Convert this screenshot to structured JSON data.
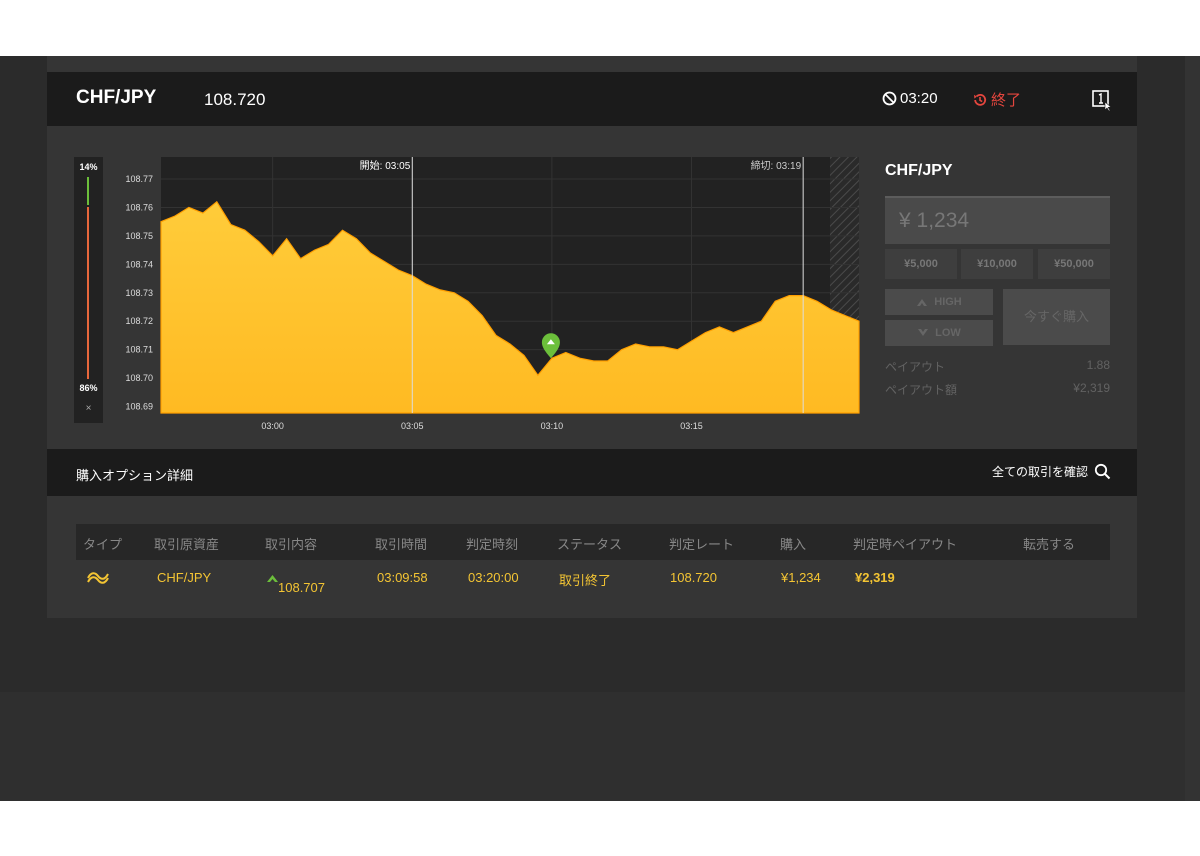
{
  "header": {
    "pair": "CHF/JPY",
    "rate": "108.720",
    "timer": "03:20",
    "status": "終了"
  },
  "sentiment": {
    "high_pct": "14%",
    "low_pct": "86%",
    "close_label": "×"
  },
  "chart_data": {
    "type": "area",
    "y_ticks": [
      "108.77",
      "108.76",
      "108.75",
      "108.74",
      "108.73",
      "108.72",
      "108.71",
      "108.70",
      "108.69"
    ],
    "x_ticks": [
      "03:00",
      "03:05",
      "03:10",
      "03:15"
    ],
    "x_range": [
      "02:56:00",
      "03:21:00"
    ],
    "y_range": [
      108.68,
      108.77
    ],
    "start_label": "開始: 03:05",
    "end_label": "締切: 03:19",
    "entry_marker": {
      "time": "03:09:58",
      "rate": 108.707
    },
    "series": [
      {
        "color": "#ffc833",
        "points": [
          [
            "02:56:00",
            108.755
          ],
          [
            "02:56:30",
            108.757
          ],
          [
            "02:57:00",
            108.76
          ],
          [
            "02:57:30",
            108.758
          ],
          [
            "02:58:00",
            108.762
          ],
          [
            "02:58:30",
            108.754
          ],
          [
            "02:59:00",
            108.752
          ],
          [
            "02:59:30",
            108.748
          ],
          [
            "03:00:00",
            108.743
          ],
          [
            "03:00:30",
            108.749
          ],
          [
            "03:01:00",
            108.742
          ],
          [
            "03:01:30",
            108.745
          ],
          [
            "03:02:00",
            108.747
          ],
          [
            "03:02:30",
            108.752
          ],
          [
            "03:03:00",
            108.749
          ],
          [
            "03:03:30",
            108.744
          ],
          [
            "03:04:00",
            108.741
          ],
          [
            "03:04:30",
            108.738
          ],
          [
            "03:05:00",
            108.736
          ],
          [
            "03:05:30",
            108.733
          ],
          [
            "03:06:00",
            108.731
          ],
          [
            "03:06:30",
            108.73
          ],
          [
            "03:07:00",
            108.727
          ],
          [
            "03:07:30",
            108.722
          ],
          [
            "03:08:00",
            108.715
          ],
          [
            "03:08:30",
            108.712
          ],
          [
            "03:09:00",
            108.708
          ],
          [
            "03:09:30",
            108.701
          ],
          [
            "03:10:00",
            108.707
          ],
          [
            "03:10:30",
            108.709
          ],
          [
            "03:11:00",
            108.707
          ],
          [
            "03:11:30",
            108.706
          ],
          [
            "03:12:00",
            108.706
          ],
          [
            "03:12:30",
            108.71
          ],
          [
            "03:13:00",
            108.712
          ],
          [
            "03:13:30",
            108.711
          ],
          [
            "03:14:00",
            108.711
          ],
          [
            "03:14:30",
            108.71
          ],
          [
            "03:15:00",
            108.713
          ],
          [
            "03:15:30",
            108.716
          ],
          [
            "03:16:00",
            108.718
          ],
          [
            "03:16:30",
            108.716
          ],
          [
            "03:17:00",
            108.718
          ],
          [
            "03:17:30",
            108.72
          ],
          [
            "03:18:00",
            108.727
          ],
          [
            "03:18:30",
            108.729
          ],
          [
            "03:19:00",
            108.729
          ],
          [
            "03:19:30",
            108.727
          ],
          [
            "03:20:00",
            108.724
          ],
          [
            "03:20:30",
            108.722
          ],
          [
            "03:21:00",
            108.72
          ]
        ]
      }
    ]
  },
  "trade": {
    "pair": "CHF/JPY",
    "amount": "¥ 1,234",
    "quick": [
      "¥5,000",
      "¥10,000",
      "¥50,000"
    ],
    "high": "HIGH",
    "low": "LOW",
    "buy": "今すぐ購入",
    "payout_label": "ペイアウト",
    "payout": "1.88",
    "payout_amount_label": "ペイアウト額",
    "payout_amount": "¥2,319"
  },
  "options": {
    "title": "購入オプション詳細",
    "view_all": "全ての取引を確認",
    "columns": [
      "タイプ",
      "取引原資産",
      "取引内容",
      "取引時間",
      "判定時刻",
      "ステータス",
      "判定レート",
      "購入",
      "判定時ペイアウト",
      "転売する"
    ],
    "row": {
      "asset": "CHF/JPY",
      "content": "108.707",
      "trade_time": "03:09:58",
      "judge_time": "03:20:00",
      "status": "取引終了",
      "judge_rate": "108.720",
      "purchase": "¥1,234",
      "payout": "¥2,319"
    }
  }
}
